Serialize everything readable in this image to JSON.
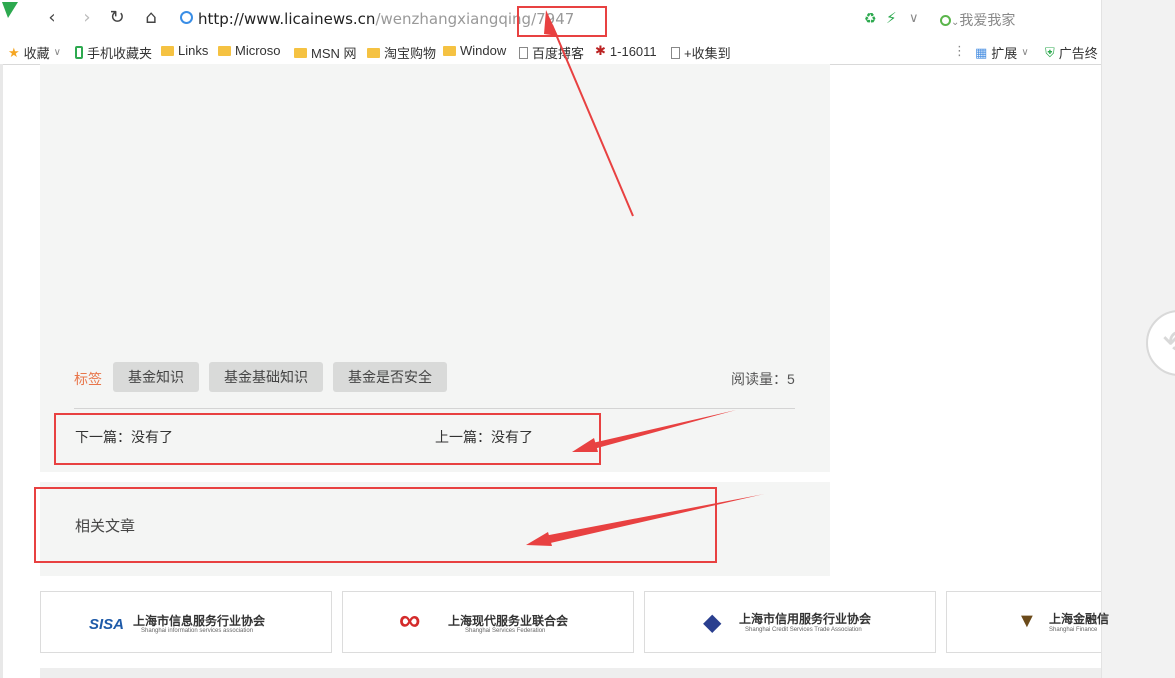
{
  "browser": {
    "url_host": "http://www.licainews.cn",
    "url_path": "/wenzhangxiangqing/7947",
    "search_placeholder": "我爱我家",
    "nav": {
      "back": "‹",
      "forward": "›",
      "refresh": "↻",
      "home": "⌂"
    }
  },
  "bookmarks": {
    "items": [
      {
        "label": "收藏",
        "icon": "star-icon"
      },
      {
        "label": "手机收藏夹",
        "icon": "phone-icon"
      },
      {
        "label": "Links",
        "icon": "folder-icon"
      },
      {
        "label": "Microso",
        "icon": "folder-icon"
      },
      {
        "label": "MSN 网",
        "icon": "folder-icon"
      },
      {
        "label": "淘宝购物",
        "icon": "folder-icon"
      },
      {
        "label": "Window",
        "icon": "folder-icon"
      },
      {
        "label": "百度搏客",
        "icon": "document-icon"
      },
      {
        "label": "1-16011",
        "icon": "bug-icon"
      },
      {
        "label": "+收集到",
        "icon": "document-icon"
      }
    ],
    "extensions_label": "扩展",
    "adblock_label": "广告终"
  },
  "article": {
    "tags_label": "标签",
    "tags": [
      "基金知识",
      "基金基础知识",
      "基金是否安全"
    ],
    "views_label": "阅读量：5",
    "next_label": "下一篇：没有了",
    "prev_label": "上一篇：没有了",
    "related_title": "相关文章"
  },
  "partners": [
    {
      "mark": "SISA",
      "name": "上海市信息服务行业协会",
      "subtitle": "Shanghai information services association"
    },
    {
      "mark": "∞",
      "name": "上海现代服务业联合会",
      "subtitle": "Shanghai Services Federation"
    },
    {
      "mark": "◆",
      "name": "上海市信用服务行业协会",
      "subtitle": "Shanghai Credit Services Trade Association"
    },
    {
      "mark": "▼",
      "name": "上海金融信",
      "subtitle": "Shanghai Finance"
    }
  ],
  "colors": {
    "accent_red": "#e84141",
    "tag_label": "#e8764a",
    "panel_bg": "#f4f5f4"
  }
}
